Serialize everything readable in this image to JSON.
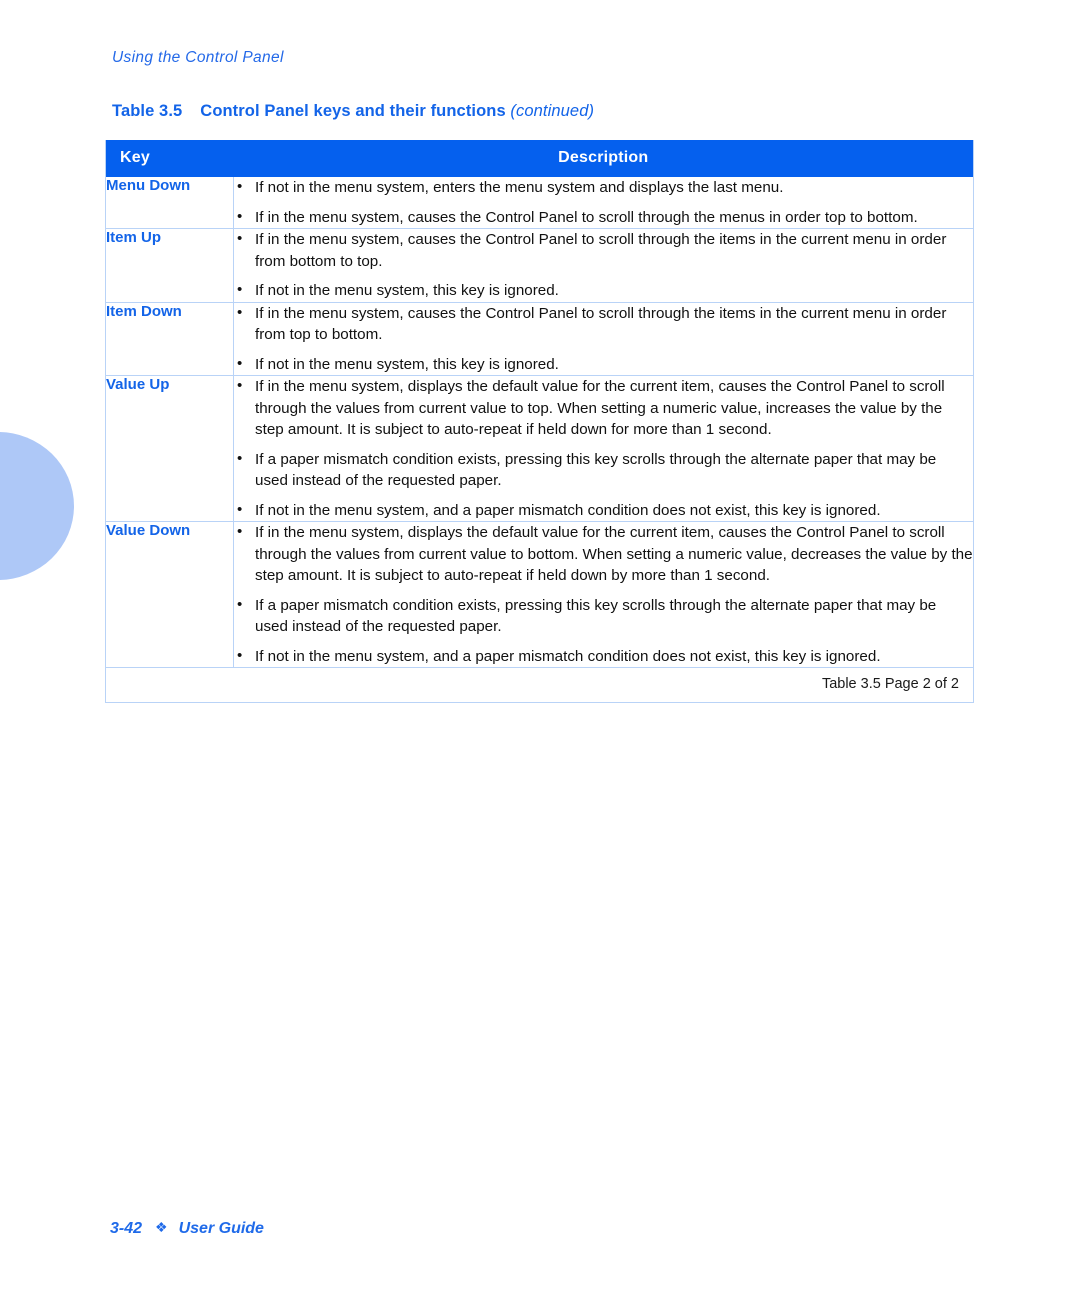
{
  "running_head": "Using the Control Panel",
  "table_caption": {
    "number": "Table 3.5",
    "title": "Control Panel keys and their functions",
    "continued": "(continued)"
  },
  "colors": {
    "header_blue": "#0560ee",
    "accent_blue": "#1364e8",
    "border_blue": "#b9d3f7",
    "deco_circle": "#aec8f7"
  },
  "table": {
    "headers": {
      "key": "Key",
      "description": "Description"
    },
    "rows": [
      {
        "key": "Menu Down",
        "bullets": [
          "If not in the menu system, enters the menu system and displays the last menu.",
          "If in the menu system, causes the Control Panel to scroll through the menus in order top to bottom."
        ]
      },
      {
        "key": "Item Up",
        "bullets": [
          "If in the menu system, causes the Control Panel to scroll through the items in the current menu in order from bottom to top.",
          "If not in the menu system, this key is ignored."
        ]
      },
      {
        "key": "Item Down",
        "bullets": [
          "If in the menu system, causes the Control Panel to scroll through the items in the current menu in order from top to bottom.",
          "If not in the menu system, this key is ignored."
        ]
      },
      {
        "key": "Value Up",
        "bullets": [
          "If in the menu system, displays the default value for the current item, causes the Control Panel to scroll through the values from current value to top. When setting a numeric value, increases the value by the step amount. It is subject to auto-repeat if held down for more than 1 second.",
          "If a paper mismatch condition exists, pressing this key scrolls through the alternate paper that may be used instead of the requested paper.",
          "If not in the menu system, and a paper mismatch condition does not exist, this key is ignored."
        ]
      },
      {
        "key": "Value Down",
        "bullets": [
          "If in the menu system, displays the default value for the current item, causes the Control Panel to scroll through the values from current value to bottom. When setting a numeric value, decreases the value by the step amount. It is subject to auto-repeat if held down by more than 1 second.",
          "If a paper mismatch condition exists, pressing this key scrolls through the alternate paper that may be used instead of the requested paper.",
          "If not in the menu system, and a paper mismatch condition does not exist, this key is ignored."
        ]
      }
    ],
    "footer_note": "Table 3.5  Page 2 of 2"
  },
  "page_footer": {
    "page_number": "3-42",
    "separator": "❖",
    "label": "User Guide"
  }
}
